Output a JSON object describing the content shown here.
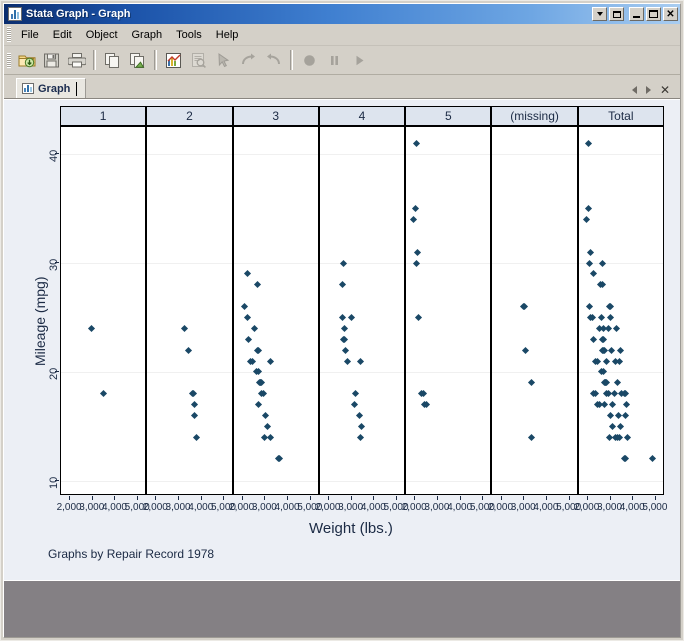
{
  "window": {
    "title": "Stata Graph - Graph",
    "icon": "graph-window-icon",
    "buttons": {
      "dropdown": "▾",
      "restore": "restore",
      "minimize": "minimize",
      "maximize": "maximize",
      "close": "✕"
    }
  },
  "menu": {
    "items": [
      {
        "label": "File"
      },
      {
        "label": "Edit"
      },
      {
        "label": "Object"
      },
      {
        "label": "Graph"
      },
      {
        "label": "Tools"
      },
      {
        "label": "Help"
      }
    ]
  },
  "toolbar": {
    "buttons": [
      {
        "name": "open-icon",
        "title": "Open",
        "enabled": true
      },
      {
        "name": "save-icon",
        "title": "Save",
        "enabled": true
      },
      {
        "name": "print-icon",
        "title": "Print",
        "enabled": true
      },
      {
        "name": "copy-icon",
        "title": "Copy",
        "enabled": true
      },
      {
        "name": "save-as-icon",
        "title": "Save as picture",
        "enabled": true
      },
      {
        "name": "graph-editor-icon",
        "title": "Start Graph Editor",
        "enabled": true
      },
      {
        "name": "preview-icon",
        "title": "Preview",
        "enabled": false
      },
      {
        "name": "pointer-icon",
        "title": "Pointer tool",
        "enabled": false
      },
      {
        "name": "redo-icon",
        "title": "Redo",
        "enabled": false
      },
      {
        "name": "undo-icon",
        "title": "Undo",
        "enabled": false
      },
      {
        "name": "record-icon",
        "title": "Record",
        "enabled": false
      },
      {
        "name": "pause-icon",
        "title": "Pause",
        "enabled": false
      },
      {
        "name": "play-icon",
        "title": "Play",
        "enabled": false
      }
    ]
  },
  "tabs": {
    "active": "Graph",
    "items": [
      {
        "label": "Graph"
      }
    ],
    "nav": {
      "prev": "prev-tab",
      "next": "next-tab",
      "close": "✕"
    }
  },
  "chart_data": {
    "type": "scatter",
    "title": "",
    "xlabel": "Weight (lbs.)",
    "ylabel": "Mileage (mpg)",
    "note": "Graphs by Repair Record 1978",
    "xlim": [
      1600,
      5400
    ],
    "ylim": [
      8.6,
      42.5
    ],
    "yticks": [
      10,
      20,
      30,
      40
    ],
    "xticks": [
      2000,
      3000,
      4000,
      5000
    ],
    "xticklabels": [
      "2,000",
      "3,000",
      "4,000",
      "5,000"
    ],
    "grid": "horizontal",
    "marker_color": "#1a4866",
    "panel_variable": "Repair Record 1978",
    "panels": [
      {
        "label": "1",
        "points": [
          [
            2930,
            24
          ],
          [
            3470,
            18
          ]
        ]
      },
      {
        "label": "2",
        "points": [
          [
            3250,
            24
          ],
          [
            3420,
            22
          ],
          [
            3600,
            18
          ],
          [
            3650,
            18
          ],
          [
            3690,
            17
          ],
          [
            3670,
            16
          ],
          [
            3760,
            14
          ]
        ]
      },
      {
        "label": "3",
        "points": [
          [
            2230,
            29
          ],
          [
            2650,
            28
          ],
          [
            2070,
            26
          ],
          [
            2200,
            25
          ],
          [
            2520,
            24
          ],
          [
            2240,
            23
          ],
          [
            2640,
            22
          ],
          [
            2680,
            22
          ],
          [
            2330,
            21
          ],
          [
            2440,
            21
          ],
          [
            3210,
            21
          ],
          [
            2590,
            20
          ],
          [
            2690,
            20
          ],
          [
            2750,
            19
          ],
          [
            2780,
            19
          ],
          [
            2800,
            19
          ],
          [
            2830,
            19
          ],
          [
            2830,
            18
          ],
          [
            2930,
            18
          ],
          [
            2720,
            17
          ],
          [
            3020,
            16
          ],
          [
            3100,
            15
          ],
          [
            2970,
            14
          ],
          [
            3230,
            14
          ],
          [
            3600,
            12
          ],
          [
            3640,
            12
          ]
        ]
      },
      {
        "label": "4",
        "points": [
          [
            2650,
            30
          ],
          [
            2580,
            28
          ],
          [
            2600,
            25
          ],
          [
            2980,
            25
          ],
          [
            2690,
            24
          ],
          [
            2640,
            23
          ],
          [
            2700,
            23
          ],
          [
            2750,
            22
          ],
          [
            2830,
            21
          ],
          [
            3400,
            21
          ],
          [
            3180,
            18
          ],
          [
            3110,
            17
          ],
          [
            3350,
            16
          ],
          [
            3430,
            15
          ],
          [
            3400,
            14
          ]
        ]
      },
      {
        "label": "5",
        "points": [
          [
            2050,
            41
          ],
          [
            2020,
            35
          ],
          [
            1930,
            34
          ],
          [
            2100,
            31
          ],
          [
            2070,
            30
          ],
          [
            2130,
            25
          ],
          [
            2270,
            18
          ],
          [
            2350,
            18
          ],
          [
            2420,
            17
          ],
          [
            2500,
            17
          ]
        ]
      },
      {
        "label": "(missing)",
        "points": [
          [
            2950,
            26
          ],
          [
            3020,
            26
          ],
          [
            3060,
            22
          ],
          [
            3310,
            19
          ],
          [
            3300,
            14
          ]
        ]
      },
      {
        "label": "Total",
        "points": [
          [
            2050,
            41
          ],
          [
            2020,
            35
          ],
          [
            1930,
            34
          ],
          [
            2100,
            31
          ],
          [
            2070,
            30
          ],
          [
            2650,
            30
          ],
          [
            2230,
            29
          ],
          [
            2580,
            28
          ],
          [
            2650,
            28
          ],
          [
            2130,
            25
          ],
          [
            2600,
            25
          ],
          [
            2980,
            25
          ],
          [
            2070,
            26
          ],
          [
            2950,
            26
          ],
          [
            3020,
            26
          ],
          [
            2200,
            25
          ],
          [
            2520,
            24
          ],
          [
            2690,
            24
          ],
          [
            2930,
            24
          ],
          [
            3250,
            24
          ],
          [
            2240,
            23
          ],
          [
            2640,
            23
          ],
          [
            2700,
            23
          ],
          [
            2640,
            22
          ],
          [
            2680,
            22
          ],
          [
            2750,
            22
          ],
          [
            3060,
            22
          ],
          [
            3420,
            22
          ],
          [
            2330,
            21
          ],
          [
            2440,
            21
          ],
          [
            2830,
            21
          ],
          [
            3210,
            21
          ],
          [
            3400,
            21
          ],
          [
            2590,
            20
          ],
          [
            2690,
            20
          ],
          [
            2750,
            19
          ],
          [
            2780,
            19
          ],
          [
            2800,
            19
          ],
          [
            2830,
            19
          ],
          [
            3310,
            19
          ],
          [
            2270,
            18
          ],
          [
            2350,
            18
          ],
          [
            2830,
            18
          ],
          [
            2930,
            18
          ],
          [
            3180,
            18
          ],
          [
            3470,
            18
          ],
          [
            3600,
            18
          ],
          [
            3650,
            18
          ],
          [
            2420,
            17
          ],
          [
            2500,
            17
          ],
          [
            2720,
            17
          ],
          [
            3110,
            17
          ],
          [
            3690,
            17
          ],
          [
            3020,
            16
          ],
          [
            3350,
            16
          ],
          [
            3670,
            16
          ],
          [
            3100,
            15
          ],
          [
            3430,
            15
          ],
          [
            2970,
            14
          ],
          [
            3230,
            14
          ],
          [
            3300,
            14
          ],
          [
            3400,
            14
          ],
          [
            3760,
            14
          ],
          [
            3600,
            12
          ],
          [
            3640,
            12
          ],
          [
            4840,
            12
          ]
        ]
      }
    ]
  }
}
